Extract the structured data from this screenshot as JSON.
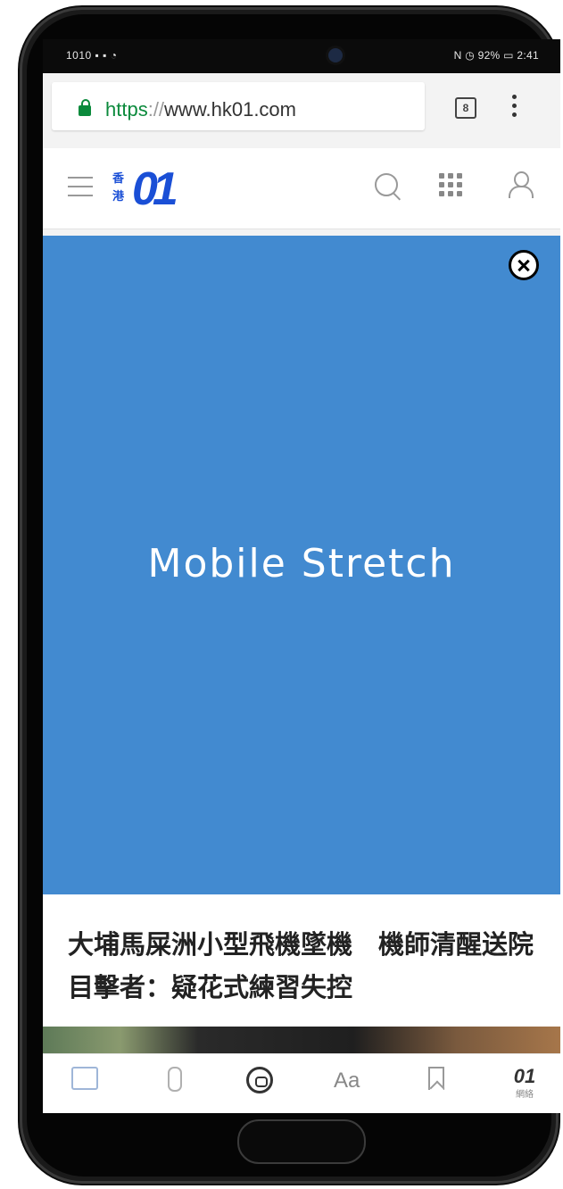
{
  "status_bar": {
    "left": "1010 ▪ ▪ ◔",
    "right": "N ◷ 92% ▭ 2:41"
  },
  "browser": {
    "url_scheme": "https",
    "url_sep": "://",
    "url_host": "www.hk01.com",
    "tab_count": "8"
  },
  "site": {
    "logo_top": "香",
    "logo_bottom": "港",
    "logo_mark": "01"
  },
  "ad": {
    "label": "Mobile Stretch",
    "background": "#428ad0"
  },
  "article": {
    "headline": "大埔馬屎洲小型飛機墜機　機師清醒送院　目擊者：疑花式練習失控"
  },
  "toolbar": {
    "font_size_label": "Aa",
    "app_logo": "01",
    "app_sub": "網絡"
  },
  "colors": {
    "brand": "#1a4fd6",
    "secure": "#0b8a3c"
  }
}
